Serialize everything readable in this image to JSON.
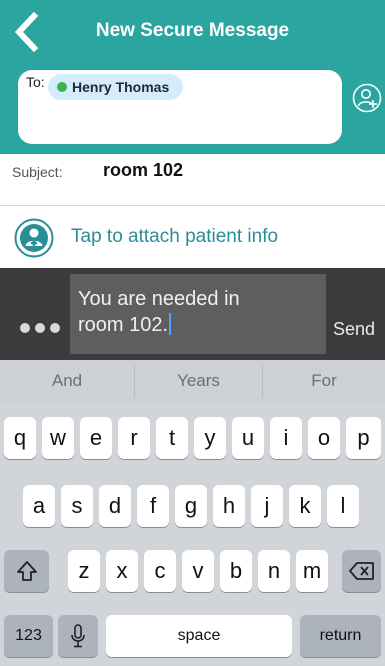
{
  "header": {
    "title": "New Secure Message"
  },
  "recipients": {
    "to_label": "To:",
    "chips": [
      {
        "name": "Henry Thomas",
        "status_color": "#3bb34a"
      }
    ]
  },
  "subject": {
    "label": "Subject:",
    "value": "room 102"
  },
  "attach": {
    "label": "Tap to attach patient info"
  },
  "composer": {
    "text_line1": "You are needed in",
    "text_line2": "room 102.",
    "send_label": "Send"
  },
  "keyboard": {
    "suggestions": [
      "And",
      "Years",
      "For"
    ],
    "row1": [
      "q",
      "w",
      "e",
      "r",
      "t",
      "y",
      "u",
      "i",
      "o",
      "p"
    ],
    "row2": [
      "a",
      "s",
      "d",
      "f",
      "g",
      "h",
      "j",
      "k",
      "l"
    ],
    "row3": [
      "z",
      "x",
      "c",
      "v",
      "b",
      "n",
      "m"
    ],
    "numbers_label": "123",
    "space_label": "space",
    "return_label": "return"
  },
  "icons": {
    "back": "chevron-left-icon",
    "add_recipient": "add-user-icon",
    "attach": "patient-icon",
    "more": "ellipsis-icon",
    "shift": "shift-icon",
    "backspace": "backspace-icon",
    "mic": "microphone-icon"
  },
  "colors": {
    "brand": "#2aa59f",
    "chip_bg": "#d4ecfb",
    "status_online": "#3bb34a",
    "composer_bg": "#3b3b3b"
  }
}
